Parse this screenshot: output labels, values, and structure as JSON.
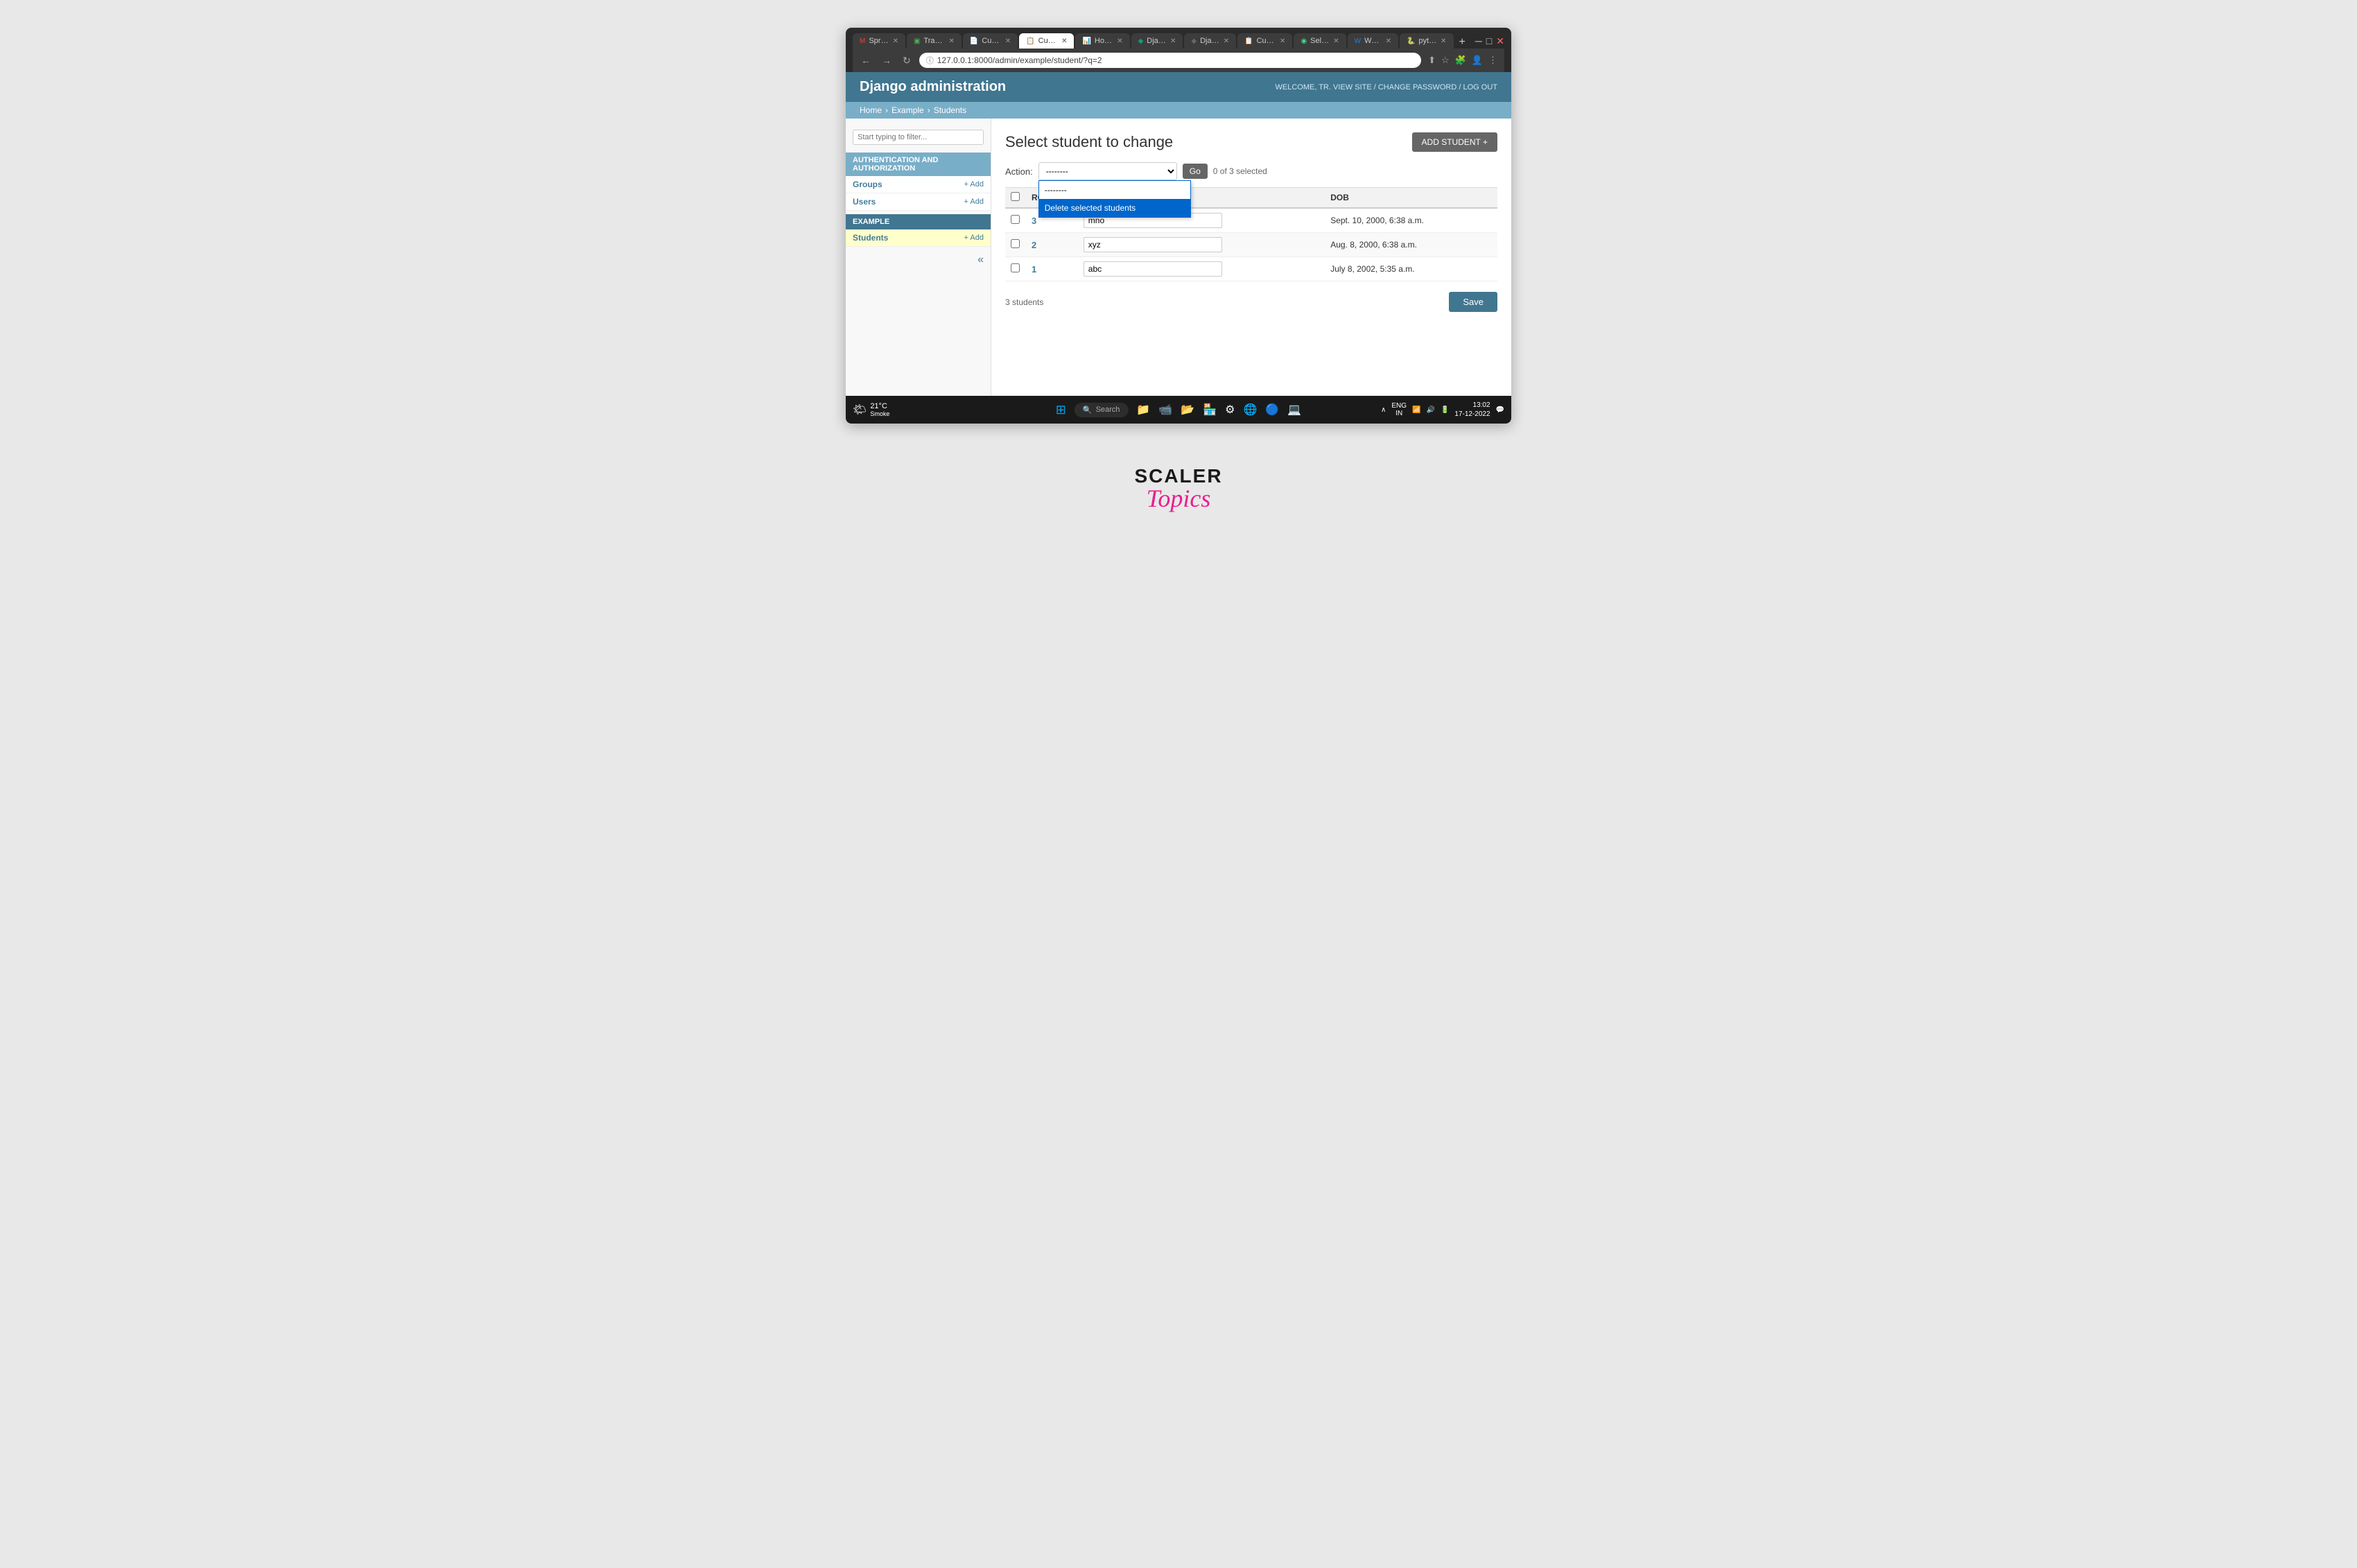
{
  "browser": {
    "tabs": [
      {
        "label": "Spre...",
        "icon": "gmail",
        "active": false
      },
      {
        "label": "Trapt...",
        "icon": "trapt",
        "active": false
      },
      {
        "label": "Cust...",
        "icon": "doc",
        "active": false
      },
      {
        "label": "Cust...",
        "icon": "doc-blue",
        "active": false
      },
      {
        "label": "How...",
        "icon": "bar",
        "active": false
      },
      {
        "label": "Djan...",
        "icon": "django-green",
        "active": false
      },
      {
        "label": "Djan...",
        "icon": "django-dark",
        "active": false
      },
      {
        "label": "Cust...",
        "icon": "doc-blue2",
        "active": true
      },
      {
        "label": "Sele...",
        "icon": "globe",
        "active": false
      },
      {
        "label": "Wor...",
        "icon": "word",
        "active": false
      },
      {
        "label": "pyth...",
        "icon": "python",
        "active": false
      }
    ],
    "url": "127.0.0.1:8000/admin/example/student/?q=2",
    "window_controls": [
      "minimize",
      "maximize",
      "close"
    ]
  },
  "django": {
    "title": "Django administration",
    "user_info": "WELCOME, TR. VIEW SITE / CHANGE PASSWORD / LOG OUT",
    "breadcrumb": [
      "Home",
      "Example",
      "Students"
    ],
    "sidebar": {
      "filter_placeholder": "Start typing to filter...",
      "sections": [
        {
          "header": "AUTHENTICATION AND AUTHORIZATION",
          "items": [
            {
              "name": "Groups",
              "add_label": "+ Add"
            },
            {
              "name": "Users",
              "add_label": "+ Add"
            }
          ]
        },
        {
          "header": "EXAMPLE",
          "items": [
            {
              "name": "Students",
              "add_label": "+ Add",
              "active": true
            }
          ]
        }
      ]
    },
    "main": {
      "page_title": "Select student to change",
      "add_button_label": "ADD STUDENT +",
      "action": {
        "label": "Action:",
        "select_value": "--------",
        "options": [
          "--------",
          "Delete selected students"
        ],
        "dropdown_open": true,
        "dropdown_highlighted": "Delete selected students",
        "go_label": "Go",
        "selected_count": "0 of 3 selected"
      },
      "table": {
        "headers": [
          "",
          "ROW",
          "",
          "DOB"
        ],
        "rows": [
          {
            "id": "3",
            "name": "mno",
            "dob": "Sept. 10, 2000, 6:38 a.m."
          },
          {
            "id": "2",
            "name": "xyz",
            "dob": "Aug. 8, 2000, 6:38 a.m."
          },
          {
            "id": "1",
            "name": "abc",
            "dob": "July 8, 2002, 5:35 a.m."
          }
        ]
      },
      "footer": {
        "count_text": "3 students",
        "save_label": "Save"
      }
    }
  },
  "taskbar": {
    "weather_temp": "21°C",
    "weather_desc": "Smoke",
    "search_label": "Search",
    "time": "13:02",
    "date": "17-12-2022",
    "lang": "ENG\nIN"
  },
  "scaler": {
    "topics_label": "SCALER",
    "cursive_label": "Topics"
  }
}
